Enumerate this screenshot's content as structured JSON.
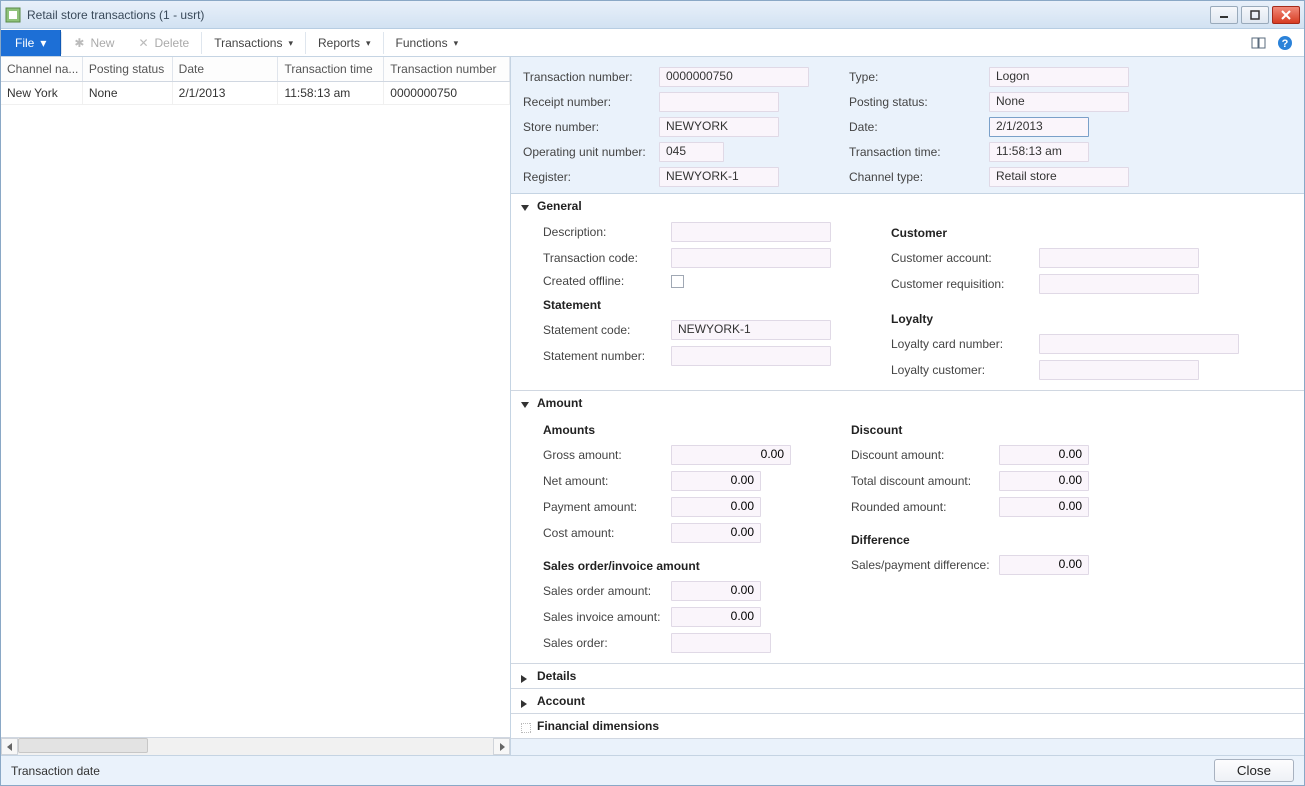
{
  "window": {
    "title": "Retail store transactions (1 - usrt)"
  },
  "toolbar": {
    "file": "File",
    "new": "New",
    "delete": "Delete",
    "transactions": "Transactions",
    "reports": "Reports",
    "functions": "Functions"
  },
  "grid": {
    "headers": {
      "channel": "Channel na...",
      "posting": "Posting status",
      "date": "Date",
      "time": "Transaction time",
      "number": "Transaction number"
    },
    "rows": [
      {
        "channel": "New York",
        "posting": "None",
        "date": "2/1/2013",
        "time": "11:58:13 am",
        "number": "0000000750"
      }
    ]
  },
  "header_fields": {
    "left": {
      "transaction_number_label": "Transaction number:",
      "transaction_number": "0000000750",
      "receipt_number_label": "Receipt number:",
      "receipt_number": "",
      "store_number_label": "Store number:",
      "store_number": "NEWYORK",
      "operating_unit_label": "Operating unit number:",
      "operating_unit": "045",
      "register_label": "Register:",
      "register": "NEWYORK-1"
    },
    "right": {
      "type_label": "Type:",
      "type": "Logon",
      "posting_status_label": "Posting status:",
      "posting_status": "None",
      "date_label": "Date:",
      "date": "2/1/2013",
      "transaction_time_label": "Transaction time:",
      "transaction_time": "11:58:13 am",
      "channel_type_label": "Channel type:",
      "channel_type": "Retail store"
    }
  },
  "sections": {
    "general": {
      "title": "General",
      "left": {
        "description_label": "Description:",
        "description": "",
        "transaction_code_label": "Transaction code:",
        "transaction_code": "",
        "created_offline_label": "Created offline:",
        "statement_heading": "Statement",
        "statement_code_label": "Statement code:",
        "statement_code": "NEWYORK-1",
        "statement_number_label": "Statement number:",
        "statement_number": ""
      },
      "right": {
        "customer_heading": "Customer",
        "customer_account_label": "Customer account:",
        "customer_account": "",
        "customer_requisition_label": "Customer requisition:",
        "customer_requisition": "",
        "loyalty_heading": "Loyalty",
        "loyalty_card_label": "Loyalty card number:",
        "loyalty_card": "",
        "loyalty_customer_label": "Loyalty customer:",
        "loyalty_customer": ""
      }
    },
    "amount": {
      "title": "Amount",
      "left": {
        "amounts_heading": "Amounts",
        "gross_label": "Gross amount:",
        "gross": "0.00",
        "net_label": "Net amount:",
        "net": "0.00",
        "payment_label": "Payment amount:",
        "payment": "0.00",
        "cost_label": "Cost amount:",
        "cost": "0.00",
        "sales_order_heading": "Sales order/invoice amount",
        "sales_order_amount_label": "Sales order amount:",
        "sales_order_amount": "0.00",
        "sales_invoice_amount_label": "Sales invoice amount:",
        "sales_invoice_amount": "0.00",
        "sales_order_label": "Sales order:",
        "sales_order": ""
      },
      "right": {
        "discount_heading": "Discount",
        "discount_amount_label": "Discount amount:",
        "discount_amount": "0.00",
        "total_discount_label": "Total discount amount:",
        "total_discount": "0.00",
        "rounded_amount_label": "Rounded amount:",
        "rounded_amount": "0.00",
        "difference_heading": "Difference",
        "sales_payment_diff_label": "Sales/payment difference:",
        "sales_payment_diff": "0.00"
      }
    },
    "details": {
      "title": "Details"
    },
    "account": {
      "title": "Account"
    },
    "financial": {
      "title": "Financial dimensions"
    }
  },
  "status_bar": {
    "text": "Transaction date",
    "close": "Close"
  }
}
